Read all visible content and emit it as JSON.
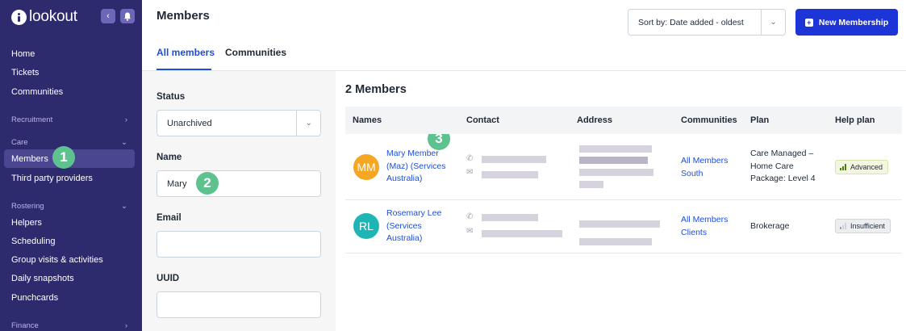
{
  "app": {
    "logo_text": "lookout"
  },
  "sidebar": {
    "collapse_icon": "chevron-left-icon",
    "bell_icon": "bell-icon",
    "items": [
      {
        "label": "Home"
      },
      {
        "label": "Tickets"
      },
      {
        "label": "Communities"
      }
    ],
    "sections": {
      "recruitment": "Recruitment",
      "care": "Care",
      "rostering": "Rostering",
      "finance": "Finance"
    },
    "care_items": [
      {
        "label": "Members"
      },
      {
        "label": "Third party providers"
      }
    ],
    "rostering_items": [
      {
        "label": "Helpers"
      },
      {
        "label": "Scheduling"
      },
      {
        "label": "Group visits & activities"
      },
      {
        "label": "Daily snapshots"
      },
      {
        "label": "Punchcards"
      }
    ]
  },
  "header": {
    "title": "Members",
    "tabs": [
      {
        "label": "All members"
      },
      {
        "label": "Communities"
      }
    ],
    "sort_label": "Sort by: Date added - oldest",
    "new_button": "New Membership"
  },
  "filters": {
    "status_label": "Status",
    "status_value": "Unarchived",
    "name_label": "Name",
    "name_value": "Mary",
    "email_label": "Email",
    "email_value": "",
    "uuid_label": "UUID",
    "uuid_value": ""
  },
  "annotations": [
    "1",
    "2",
    "3"
  ],
  "table": {
    "count": "2 Members",
    "columns": [
      "Names",
      "Contact",
      "Address",
      "Communities",
      "Plan",
      "Help plan"
    ],
    "rows": [
      {
        "initials": "MM",
        "avatar_color": "#f5a623",
        "name_lines": [
          "Mary Member",
          "(Maz) (Services",
          "Australia)"
        ],
        "community_lines": [
          "All Members",
          "South"
        ],
        "plan_lines": [
          "Care Managed –",
          "Home Care",
          "Package: Level 4"
        ],
        "help_plan": "Advanced"
      },
      {
        "initials": "RL",
        "avatar_color": "#1fb5b5",
        "name_lines": [
          "Rosemary Lee",
          "(Services",
          "Australia)"
        ],
        "community_lines": [
          "All Members",
          "Clients"
        ],
        "plan_lines": [
          "Brokerage"
        ],
        "help_plan": "Insufficient"
      }
    ]
  },
  "colors": {
    "sidebar": "#2d2a6e",
    "accent": "#1d4ed8",
    "primary_button": "#1d35d6",
    "annotation": "#5ec28f"
  }
}
